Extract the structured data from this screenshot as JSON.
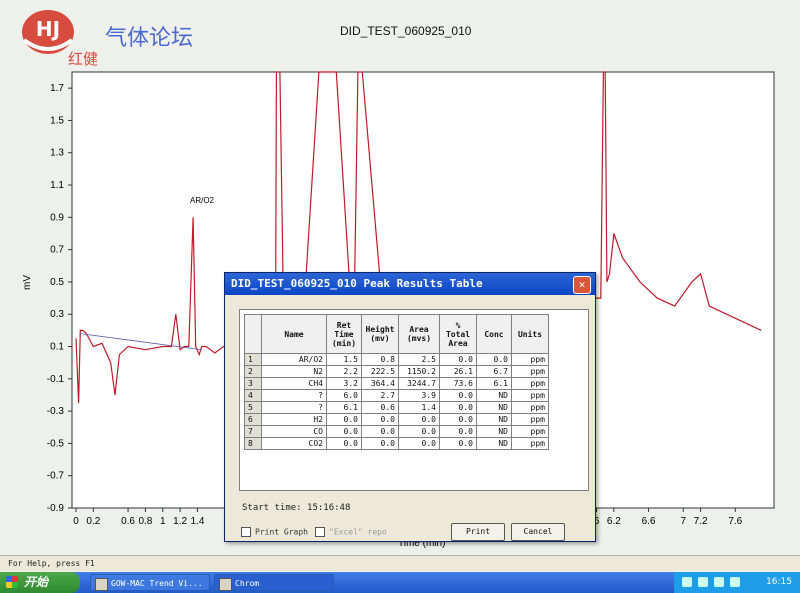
{
  "logo": {
    "brand": "气体论坛",
    "sub": "红健"
  },
  "chart": {
    "title": "DID_TEST_060925_010",
    "ylabel": "mV",
    "xlabel": "Time (min)",
    "y_ticks": [
      "1.7",
      "1.5",
      "1.3",
      "1.1",
      "0.9",
      "0.7",
      "0.5",
      "0.3",
      "0.1",
      "-0.1",
      "-0.3",
      "-0.5",
      "-0.7",
      "-0.9"
    ],
    "x_ticks": [
      "0",
      "0.2",
      "0.6",
      "0.8",
      "1",
      "1.2",
      "1.4",
      "6",
      "6.2",
      "6.6",
      "7",
      "7.2",
      "7.6"
    ],
    "peak_label": "AR/O2"
  },
  "chart_data": {
    "type": "line",
    "title": "DID_TEST_060925_010",
    "xlabel": "Time (min)",
    "ylabel": "mV",
    "xlim": [
      0,
      8.0
    ],
    "ylim": [
      -0.9,
      1.8
    ],
    "series": [
      {
        "x": [
          0.0,
          0.03,
          0.05,
          0.08,
          0.12,
          0.2,
          0.3,
          0.4,
          0.45,
          0.5,
          0.6,
          0.8,
          1.0,
          1.1,
          1.15,
          1.2,
          1.25,
          1.3,
          1.35,
          1.38,
          1.42,
          1.45,
          1.5,
          1.55,
          1.6,
          1.7,
          1.8,
          2.0,
          2.2,
          2.3,
          2.31,
          2.35,
          2.4,
          2.6,
          2.8,
          3.0,
          3.2,
          3.25,
          3.3,
          3.5,
          3.8,
          4.0,
          4.2,
          4.5,
          5.5,
          5.8,
          5.82,
          5.9,
          6.0,
          6.05,
          6.08,
          6.1,
          6.12,
          6.15,
          6.2,
          6.3,
          6.5,
          6.7,
          6.9,
          7.1,
          7.2,
          7.3,
          7.5,
          7.7,
          7.9
        ],
        "y": [
          0.15,
          -0.25,
          0.2,
          0.2,
          0.18,
          0.1,
          0.12,
          0.0,
          -0.2,
          0.05,
          0.1,
          0.08,
          0.1,
          0.1,
          0.3,
          0.08,
          0.1,
          0.1,
          0.9,
          0.1,
          0.05,
          0.1,
          0.1,
          0.08,
          0.06,
          0.1,
          0.08,
          0.05,
          0.1,
          0.1,
          1.8,
          1.8,
          0.05,
          0.1,
          1.8,
          1.8,
          0.1,
          1.8,
          1.8,
          0.55,
          0.1,
          0.1,
          0.05,
          0.0,
          -0.2,
          -0.6,
          -0.6,
          0.35,
          0.4,
          0.4,
          1.8,
          1.8,
          0.5,
          0.55,
          0.8,
          0.65,
          0.5,
          0.4,
          0.35,
          0.5,
          0.55,
          0.35,
          0.3,
          0.25,
          0.2
        ]
      }
    ],
    "annotations": [
      "AR/O2"
    ]
  },
  "dialog": {
    "title": "DID_TEST_060925_010 Peak Results Table",
    "close": "✕",
    "columns": [
      "Name",
      "Ret Time (min)",
      "Height (mv)",
      "Area (mvs)",
      "% Total Area",
      "Conc",
      "Units"
    ],
    "rows": [
      {
        "idx": "1",
        "name": "AR/O2",
        "ret": "1.5",
        "height": "0.8",
        "area": "2.5",
        "pct": "0.0",
        "conc": "0.0",
        "units": "ppm"
      },
      {
        "idx": "2",
        "name": "N2",
        "ret": "2.2",
        "height": "222.5",
        "area": "1150.2",
        "pct": "26.1",
        "conc": "6.7",
        "units": "ppm"
      },
      {
        "idx": "3",
        "name": "CH4",
        "ret": "3.2",
        "height": "364.4",
        "area": "3244.7",
        "pct": "73.6",
        "conc": "6.1",
        "units": "ppm"
      },
      {
        "idx": "4",
        "name": "?",
        "ret": "6.0",
        "height": "2.7",
        "area": "3.9",
        "pct": "0.0",
        "conc": "ND",
        "units": "ppm"
      },
      {
        "idx": "5",
        "name": "?",
        "ret": "6.1",
        "height": "0.6",
        "area": "1.4",
        "pct": "0.0",
        "conc": "ND",
        "units": "ppm"
      },
      {
        "idx": "6",
        "name": "H2",
        "ret": "0.0",
        "height": "0.0",
        "area": "0.0",
        "pct": "0.0",
        "conc": "ND",
        "units": "ppm"
      },
      {
        "idx": "7",
        "name": "CO",
        "ret": "0.0",
        "height": "0.0",
        "area": "0.0",
        "pct": "0.0",
        "conc": "ND",
        "units": "ppm"
      },
      {
        "idx": "8",
        "name": "CO2",
        "ret": "0.0",
        "height": "0.0",
        "area": "0.0",
        "pct": "0.0",
        "conc": "ND",
        "units": "ppm"
      }
    ],
    "start_time": "Start time: 15:16:48",
    "print_graph": "Print Graph",
    "excel_report": "\"Excel\" repo",
    "print_btn": "Print",
    "cancel_btn": "Cancel"
  },
  "statusbar": {
    "text": "For Help, press F1"
  },
  "taskbar": {
    "start": "开始",
    "items": [
      "GOW-MAC Trend Vi...",
      "Chrom"
    ],
    "clock": "16:15"
  }
}
